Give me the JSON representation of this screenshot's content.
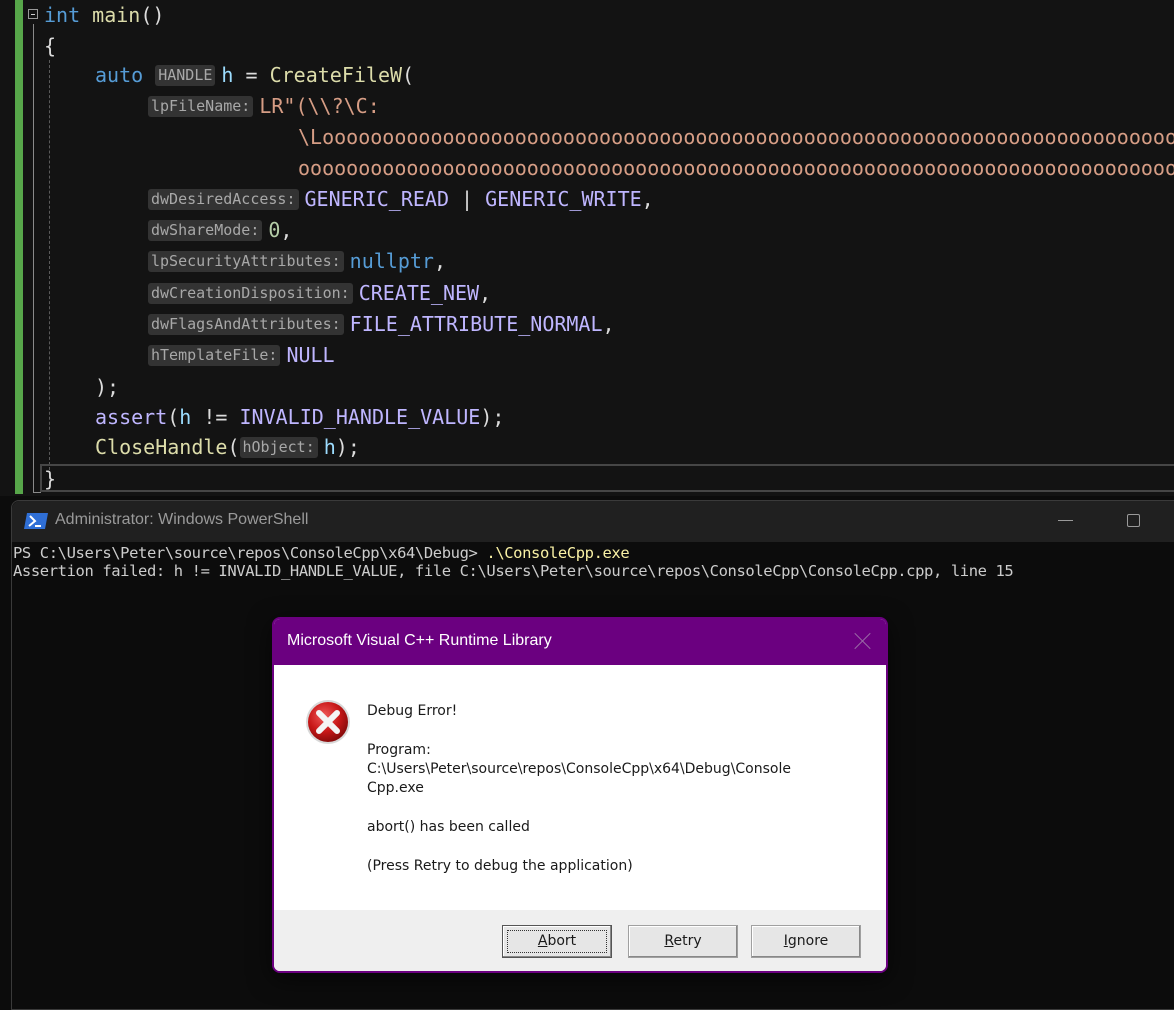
{
  "editor": {
    "lines": [
      {
        "tokens": [
          {
            "t": "int",
            "c": "kw"
          },
          {
            "t": " "
          },
          {
            "t": "main",
            "c": "fn"
          },
          {
            "t": "()"
          }
        ]
      },
      {
        "tokens": [
          {
            "t": "{"
          }
        ]
      },
      {
        "tokens": [
          {
            "t": "auto",
            "c": "kw"
          },
          {
            "t": " "
          },
          {
            "hint": "HANDLE"
          },
          {
            "t": "h",
            "c": "var"
          },
          {
            "t": " = "
          },
          {
            "t": "CreateFileW",
            "c": "fn"
          },
          {
            "t": "("
          }
        ]
      },
      {
        "tokens": [
          {
            "hint": "lpFileName:"
          },
          {
            "t": "LR\"(\\\\?\\C:",
            "c": "str"
          }
        ]
      },
      {
        "tokens": [
          {
            "t": "\\Looooooooooooooooooooooooooooooooooooooooooooooooooooooooooooooooooooooooooo",
            "c": "str"
          }
        ]
      },
      {
        "tokens": [
          {
            "t": "ooooooooooooooooooooooooooooooooooooooooooooooooooooooooooooooooooooooooooooo",
            "c": "str"
          }
        ]
      },
      {
        "tokens": [
          {
            "hint": "dwDesiredAccess:"
          },
          {
            "t": "GENERIC_READ",
            "c": "mac"
          },
          {
            "t": " | "
          },
          {
            "t": "GENERIC_WRITE",
            "c": "mac"
          },
          {
            "t": ","
          }
        ]
      },
      {
        "tokens": [
          {
            "hint": "dwShareMode:"
          },
          {
            "t": "0",
            "c": "num"
          },
          {
            "t": ","
          }
        ]
      },
      {
        "tokens": [
          {
            "hint": "lpSecurityAttributes:"
          },
          {
            "t": "nullptr",
            "c": "kw"
          },
          {
            "t": ","
          }
        ]
      },
      {
        "tokens": [
          {
            "hint": "dwCreationDisposition:"
          },
          {
            "t": "CREATE_NEW",
            "c": "mac"
          },
          {
            "t": ","
          }
        ]
      },
      {
        "tokens": [
          {
            "hint": "dwFlagsAndAttributes:"
          },
          {
            "t": "FILE_ATTRIBUTE_NORMAL",
            "c": "mac"
          },
          {
            "t": ","
          }
        ]
      },
      {
        "tokens": [
          {
            "hint": "hTemplateFile:"
          },
          {
            "t": "NULL",
            "c": "mac"
          }
        ]
      },
      {
        "tokens": [
          {
            "t": ");"
          }
        ]
      },
      {
        "tokens": [
          {
            "t": "assert",
            "c": "mac"
          },
          {
            "t": "("
          },
          {
            "t": "h",
            "c": "var"
          },
          {
            "t": " != "
          },
          {
            "t": "INVALID_HANDLE_VALUE",
            "c": "mac"
          },
          {
            "t": ");"
          }
        ]
      },
      {
        "tokens": [
          {
            "t": "CloseHandle",
            "c": "fn"
          },
          {
            "t": "("
          },
          {
            "hint": "hObject:"
          },
          {
            "t": "h",
            "c": "var"
          },
          {
            "t": ");"
          }
        ]
      },
      {
        "tokens": [
          {
            "t": "}"
          }
        ]
      }
    ]
  },
  "powershell": {
    "title": "Administrator: Windows PowerShell",
    "prompt": "PS C:\\Users\\Peter\\source\\repos\\ConsoleCpp\\x64\\Debug> ",
    "command": ".\\ConsoleCpp.exe",
    "output": "Assertion failed: h != INVALID_HANDLE_VALUE, file C:\\Users\\Peter\\source\\repos\\ConsoleCpp\\ConsoleCpp.cpp, line 15"
  },
  "dialog": {
    "title": "Microsoft Visual C++ Runtime Library",
    "heading": "Debug Error!",
    "program_label": "Program:",
    "program_path_line1": "C:\\Users\\Peter\\source\\repos\\ConsoleCpp\\x64\\Debug\\Console",
    "program_path_line2": "Cpp.exe",
    "message": "abort() has been called",
    "hint": "(Press Retry to debug the application)",
    "buttons": [
      {
        "label": "Abort",
        "accel": "A"
      },
      {
        "label": "Retry",
        "accel": "R"
      },
      {
        "label": "Ignore",
        "accel": "I"
      }
    ],
    "accent_color": "#6b0080"
  },
  "colors": {
    "editor_bg": "#131313",
    "change_bar": "#57a64a",
    "terminal_bg": "#0c0c0c"
  }
}
